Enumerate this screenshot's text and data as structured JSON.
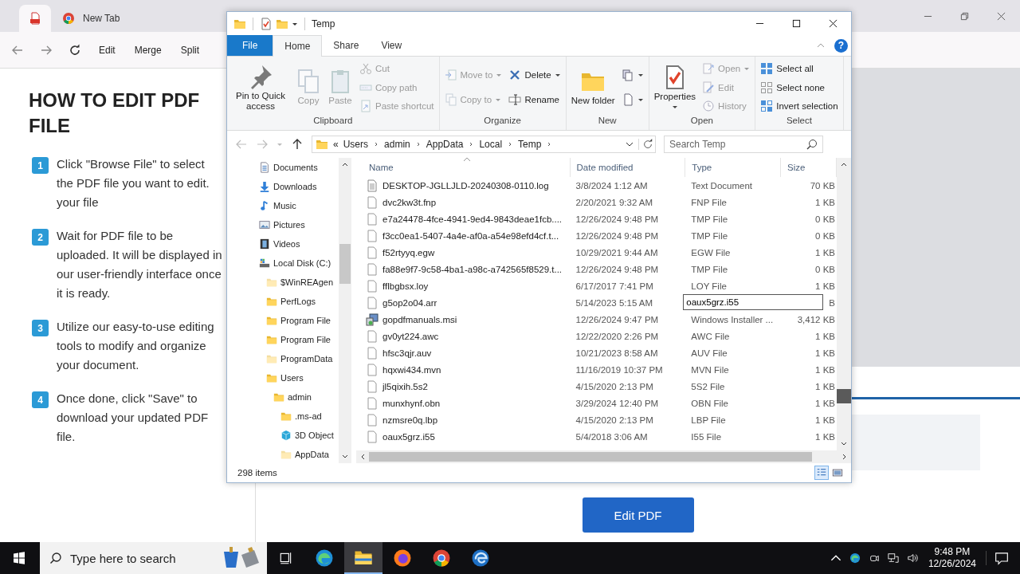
{
  "browser": {
    "tabs": [
      {
        "kind": "pdf",
        "selected": true
      },
      {
        "kind": "chrome",
        "label": "New Tab",
        "selected": false
      }
    ],
    "links": [
      "Edit",
      "Merge",
      "Split"
    ],
    "page": {
      "heading": "HOW TO EDIT PDF FILE",
      "steps": [
        {
          "number": "1",
          "text": "Click \"Browse File\" to select the PDF file you want to edit. your file"
        },
        {
          "number": "2",
          "text": "Wait for PDF file to be uploaded. It will be displayed in our user-friendly interface once it is ready."
        },
        {
          "number": "3",
          "text": "Utilize our easy-to-use editing tools to modify and organize your document."
        },
        {
          "number": "4",
          "text": "Once done, click \"Save\" to download your updated PDF file."
        }
      ],
      "button": "Edit PDF"
    }
  },
  "explorer": {
    "title": "Temp",
    "help": "?",
    "ribbon_tabs": [
      {
        "label": "File",
        "kind": "file",
        "selected": false
      },
      {
        "label": "Home",
        "kind": "tab",
        "selected": true
      },
      {
        "label": "Share",
        "kind": "tab",
        "selected": false
      },
      {
        "label": "View",
        "kind": "tab",
        "selected": false
      }
    ],
    "groups": [
      {
        "label": "Clipboard",
        "columns": [
          [
            {
              "kind": "pin",
              "label": "Pin to Quick access",
              "large": true,
              "dropdown": false,
              "disabled": false
            }
          ],
          [
            {
              "kind": "copy",
              "label": "Copy",
              "large": true,
              "dropdown": false,
              "disabled": true
            }
          ],
          [
            {
              "kind": "paste",
              "label": "Paste",
              "large": true,
              "dropdown": false,
              "disabled": true
            }
          ],
          [
            {
              "kind": "cut",
              "label": "Cut",
              "large": false,
              "dropdown": false,
              "disabled": true
            },
            {
              "kind": "copypath",
              "label": "Copy path",
              "large": false,
              "dropdown": false,
              "disabled": true
            },
            {
              "kind": "shortcut",
              "label": "Paste shortcut",
              "large": false,
              "dropdown": false,
              "disabled": true
            }
          ]
        ]
      },
      {
        "label": "Organize",
        "columns": [
          [
            {
              "kind": "move",
              "label": "Move to",
              "large": false,
              "dropdown": true,
              "disabled": true
            },
            {
              "kind": "copyto",
              "label": "Copy to",
              "large": false,
              "dropdown": true,
              "disabled": true
            }
          ],
          [
            {
              "kind": "delete",
              "label": "Delete",
              "large": false,
              "dropdown": true,
              "disabled": false
            },
            {
              "kind": "rename",
              "label": "Rename",
              "large": false,
              "dropdown": false,
              "disabled": false
            }
          ]
        ]
      },
      {
        "label": "New",
        "columns": [
          [
            {
              "kind": "folder",
              "label": "New folder",
              "large": true,
              "dropdown": false,
              "disabled": false
            }
          ],
          [
            {
              "kind": "newitem",
              "large": false,
              "dropdown": true,
              "disabled": false
            },
            {
              "kind": "easyaccess",
              "large": false,
              "dropdown": true,
              "disabled": false
            }
          ]
        ]
      },
      {
        "label": "Open",
        "columns": [
          [
            {
              "kind": "properties",
              "label": "Properties",
              "large": true,
              "dropdown": true,
              "disabled": false
            }
          ],
          [
            {
              "kind": "open",
              "label": "Open",
              "large": false,
              "dropdown": true,
              "disabled": true
            },
            {
              "kind": "edit",
              "label": "Edit",
              "large": false,
              "dropdown": false,
              "disabled": true
            },
            {
              "kind": "history",
              "label": "History",
              "large": false,
              "dropdown": false,
              "disabled": true
            }
          ]
        ]
      },
      {
        "label": "Select",
        "columns": [
          [
            {
              "kind": "selectall",
              "label": "Select all",
              "large": false,
              "dropdown": false,
              "disabled": false
            },
            {
              "kind": "selectnone",
              "label": "Select none",
              "large": false,
              "dropdown": false,
              "disabled": false
            },
            {
              "kind": "invert",
              "label": "Invert selection",
              "large": false,
              "dropdown": false,
              "disabled": false
            }
          ]
        ]
      }
    ],
    "address": {
      "prefix": "«",
      "crumbs": [
        "Users",
        "admin",
        "AppData",
        "Local",
        "Temp"
      ]
    },
    "search": {
      "placeholder": "Search Temp"
    },
    "nav": [
      {
        "kind": "documents",
        "label": "Documents",
        "hidden": false
      },
      {
        "kind": "downloads",
        "label": "Downloads",
        "hidden": false
      },
      {
        "kind": "music",
        "label": "Music",
        "hidden": false
      },
      {
        "kind": "pictures",
        "label": "Pictures",
        "hidden": false
      },
      {
        "kind": "videos",
        "label": "Videos",
        "hidden": false
      },
      {
        "kind": "drive",
        "label": "Local Disk (C:)",
        "hidden": false,
        "children": [
          {
            "kind": "folder",
            "label": "$WinREAgen",
            "hidden": true
          },
          {
            "kind": "folder",
            "label": "PerfLogs",
            "hidden": false
          },
          {
            "kind": "folder",
            "label": "Program File",
            "hidden": false
          },
          {
            "kind": "folder",
            "label": "Program File",
            "hidden": false
          },
          {
            "kind": "folder",
            "label": "ProgramData",
            "hidden": true
          },
          {
            "kind": "folder",
            "label": "Users",
            "hidden": false,
            "children": [
              {
                "kind": "folder",
                "label": "admin",
                "hidden": false,
                "children": [
                  {
                    "kind": "folder",
                    "label": ".ms-ad",
                    "hidden": false
                  },
                  {
                    "kind": "cube",
                    "label": "3D Object",
                    "hidden": false
                  },
                  {
                    "kind": "folder",
                    "label": "AppData",
                    "hidden": true
                  }
                ]
              }
            ]
          }
        ]
      }
    ],
    "columns": [
      "Name",
      "Date modified",
      "Type",
      "Size"
    ],
    "rows": [
      {
        "kind": "text",
        "name": "DESKTOP-JGLLJLD-20240308-0110.log",
        "date": "3/8/2024 1:12 AM",
        "type": "Text Document",
        "size": "70 KB"
      },
      {
        "kind": "file",
        "name": "dvc2kw3t.fnp",
        "date": "2/20/2021 9:32 AM",
        "type": "FNP File",
        "size": "1 KB"
      },
      {
        "kind": "file",
        "name": "e7a24478-4fce-4941-9ed4-9843deae1fcb....",
        "date": "12/26/2024 9:48 PM",
        "type": "TMP File",
        "size": "0 KB"
      },
      {
        "kind": "file",
        "name": "f3cc0ea1-5407-4a4e-af0a-a54e98efd4cf.t...",
        "date": "12/26/2024 9:48 PM",
        "type": "TMP File",
        "size": "0 KB"
      },
      {
        "kind": "file",
        "name": "f52rtyyq.egw",
        "date": "10/29/2021 9:44 AM",
        "type": "EGW File",
        "size": "1 KB"
      },
      {
        "kind": "file",
        "name": "fa88e9f7-9c58-4ba1-a98c-a742565f8529.t...",
        "date": "12/26/2024 9:48 PM",
        "type": "TMP File",
        "size": "0 KB"
      },
      {
        "kind": "file",
        "name": "fflbgbsx.loy",
        "date": "6/17/2017 7:41 PM",
        "type": "LOY File",
        "size": "1 KB"
      },
      {
        "kind": "file",
        "name": "g5op2o04.arr",
        "date": "5/14/2023 5:15 AM",
        "rename": "oaux5grz.i55",
        "size": "B"
      },
      {
        "kind": "installer",
        "name": "gopdfmanuals.msi",
        "date": "12/26/2024 9:47 PM",
        "type": "Windows Installer ...",
        "size": "3,412 KB"
      },
      {
        "kind": "file",
        "name": "gv0yt224.awc",
        "date": "12/22/2020 2:26 PM",
        "type": "AWC File",
        "size": "1 KB"
      },
      {
        "kind": "file",
        "name": "hfsc3qjr.auv",
        "date": "10/21/2023 8:58 AM",
        "type": "AUV File",
        "size": "1 KB"
      },
      {
        "kind": "file",
        "name": "hqxwi434.mvn",
        "date": "11/16/2019 10:37 PM",
        "type": "MVN File",
        "size": "1 KB"
      },
      {
        "kind": "file",
        "name": "jl5qixih.5s2",
        "date": "4/15/2020 2:13 PM",
        "type": "5S2 File",
        "size": "1 KB"
      },
      {
        "kind": "file",
        "name": "munxhynf.obn",
        "date": "3/29/2024 12:40 PM",
        "type": "OBN File",
        "size": "1 KB"
      },
      {
        "kind": "file",
        "name": "nzmsre0q.lbp",
        "date": "4/15/2020 2:13 PM",
        "type": "LBP File",
        "size": "1 KB"
      },
      {
        "kind": "file",
        "name": "oaux5grz.i55",
        "date": "5/4/2018 3:06 AM",
        "type": "I55 File",
        "size": "1 KB"
      }
    ],
    "status": "298 items",
    "views": [
      {
        "kind": "details",
        "selected": true
      },
      {
        "kind": "tiles",
        "selected": false
      }
    ]
  },
  "taskbar": {
    "search": {
      "placeholder": "Type here to search"
    },
    "apps": [
      {
        "kind": "edge",
        "active": false
      },
      {
        "kind": "explorer",
        "active": true
      },
      {
        "kind": "firefox",
        "active": false
      },
      {
        "kind": "chrome",
        "active": false
      },
      {
        "kind": "edgebeta",
        "active": false
      }
    ],
    "time": "9:48 PM",
    "date": "12/26/2024"
  }
}
